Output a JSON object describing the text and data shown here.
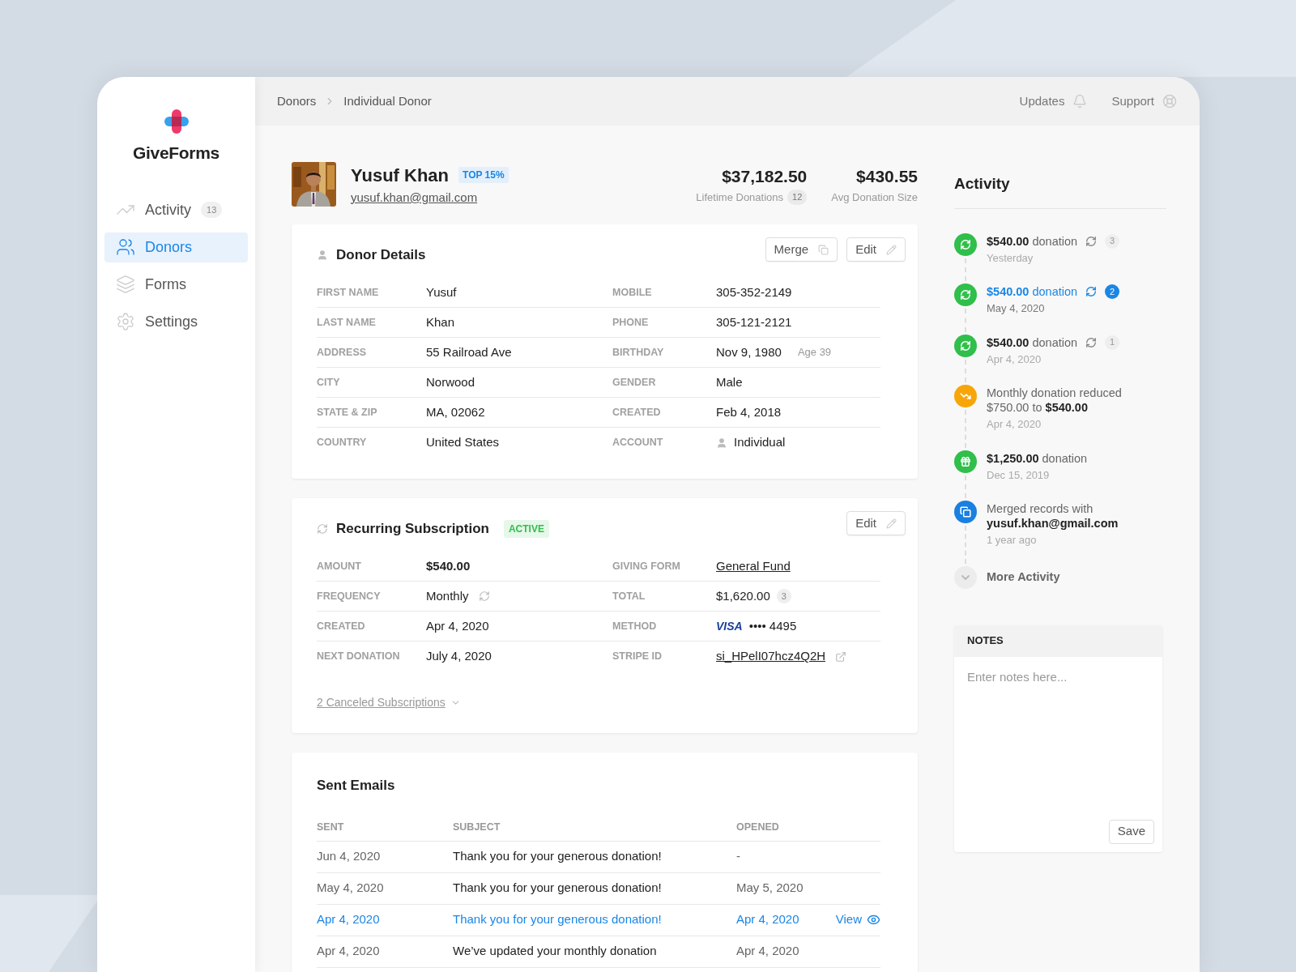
{
  "sidebar": {
    "logo": "GiveForms",
    "items": [
      {
        "label": "Activity",
        "kind": "activity",
        "count": "13",
        "selected": false
      },
      {
        "label": "Donors",
        "kind": "donors",
        "selected": true
      },
      {
        "label": "Forms",
        "kind": "forms",
        "selected": false
      },
      {
        "label": "Settings",
        "kind": "settings",
        "selected": false
      }
    ]
  },
  "topbar": {
    "breadcrumbs": [
      "Donors",
      "Individual Donor"
    ],
    "links": [
      {
        "label": "Updates",
        "kind": "bell"
      },
      {
        "label": "Support",
        "kind": "lifebuoy"
      }
    ]
  },
  "donor": {
    "name": "Yusuf Khan",
    "badge": "TOP 15%",
    "email": "yusuf.khan@gmail.com",
    "stats": [
      {
        "value": "$37,182.50",
        "label": "Lifetime Donations",
        "count": "12"
      },
      {
        "value": "$430.55",
        "label": "Avg Donation Size"
      }
    ]
  },
  "donor_details": {
    "title": "Donor Details",
    "buttons": [
      {
        "label": "Merge",
        "kind": "merge"
      },
      {
        "label": "Edit",
        "kind": "edit"
      }
    ],
    "rows": [
      {
        "left": {
          "label": "FIRST NAME",
          "value": "Yusuf",
          "kind": "text"
        },
        "right": {
          "label": "MOBILE",
          "value": "305-352-2149",
          "kind": "text"
        }
      },
      {
        "left": {
          "label": "LAST NAME",
          "value": "Khan",
          "kind": "text"
        },
        "right": {
          "label": "PHONE",
          "value": "305-121-2121",
          "kind": "text"
        }
      },
      {
        "left": {
          "label": "ADDRESS",
          "value": "55 Railroad Ave",
          "kind": "text"
        },
        "right": {
          "label": "BIRTHDAY",
          "value": "Nov 9, 1980",
          "kind": "text",
          "note": "Age 39"
        }
      },
      {
        "left": {
          "label": "CITY",
          "value": "Norwood",
          "kind": "text"
        },
        "right": {
          "label": "GENDER",
          "value": "Male",
          "kind": "text"
        }
      },
      {
        "left": {
          "label": "STATE & ZIP",
          "value": "MA, 02062",
          "kind": "text"
        },
        "right": {
          "label": "CREATED",
          "value": "Feb 4, 2018",
          "kind": "text"
        }
      },
      {
        "left": {
          "label": "COUNTRY",
          "value": "United States",
          "kind": "text"
        },
        "right": {
          "label": "ACCOUNT",
          "value": "Individual",
          "kind": "person"
        }
      }
    ]
  },
  "subscription": {
    "title": "Recurring Subscription",
    "status": "ACTIVE",
    "edit_button": "Edit",
    "rows": [
      {
        "left": {
          "label": "AMOUNT",
          "value": "$540.00",
          "kind": "strong"
        },
        "right": {
          "label": "GIVING FORM",
          "value": "General Fund",
          "kind": "link"
        }
      },
      {
        "left": {
          "label": "FREQUENCY",
          "value": "Monthly",
          "kind": "repeat"
        },
        "right": {
          "label": "TOTAL",
          "value": "$1,620.00",
          "kind": "count",
          "count": "3"
        }
      },
      {
        "left": {
          "label": "CREATED",
          "value": "Apr 4, 2020",
          "kind": "text"
        },
        "right": {
          "label": "METHOD",
          "value": "•••• 4495",
          "kind": "card",
          "brand": "VISA"
        }
      },
      {
        "left": {
          "label": "NEXT DONATION",
          "value": "July 4, 2020",
          "kind": "text"
        },
        "right": {
          "label": "STRIPE ID",
          "value": "si_HPelI07hcz4Q2H",
          "kind": "external"
        }
      }
    ],
    "canceled_link": "2 Canceled Subscriptions"
  },
  "sent_emails": {
    "title": "Sent Emails",
    "columns": [
      "SENT",
      "SUBJECT",
      "OPENED"
    ],
    "view_label": "View",
    "rows": [
      {
        "sent": "Jun 4, 2020",
        "subject": "Thank you for your generous donation!",
        "opened": "-",
        "selected": false
      },
      {
        "sent": "May 4, 2020",
        "subject": "Thank you for your generous donation!",
        "opened": "May 5, 2020",
        "selected": false
      },
      {
        "sent": "Apr 4, 2020",
        "subject": "Thank you for your generous donation!",
        "opened": "Apr 4, 2020",
        "selected": true
      },
      {
        "sent": "Apr 4, 2020",
        "subject": "We’ve updated your monthly donation",
        "opened": "Apr 4, 2020",
        "selected": false
      }
    ]
  },
  "activity": {
    "title": "Activity",
    "more": "More Activity",
    "items": [
      {
        "kind": "recurring",
        "text": "**$540.00** donation",
        "count": "3",
        "date": "Yesterday",
        "selected": false
      },
      {
        "kind": "recurring",
        "text": "**$540.00** donation",
        "count": "2",
        "date": "May 4, 2020",
        "selected": true
      },
      {
        "kind": "recurring",
        "text": "**$540.00** donation",
        "count": "1",
        "date": "Apr 4, 2020",
        "selected": false
      },
      {
        "kind": "reduced",
        "text": "Monthly donation reduced $750.00 to **$540.00**",
        "date": "Apr 4, 2020",
        "selected": false
      },
      {
        "kind": "gift",
        "text": "**$1,250.00** donation",
        "date": "Dec 15, 2019",
        "selected": false
      },
      {
        "kind": "merged",
        "text": "Merged records with **yusuf.khan@gmail.com**",
        "date": "1 year ago",
        "selected": false
      }
    ]
  },
  "notes": {
    "title": "NOTES",
    "placeholder": "Enter notes here...",
    "button": "Save"
  }
}
